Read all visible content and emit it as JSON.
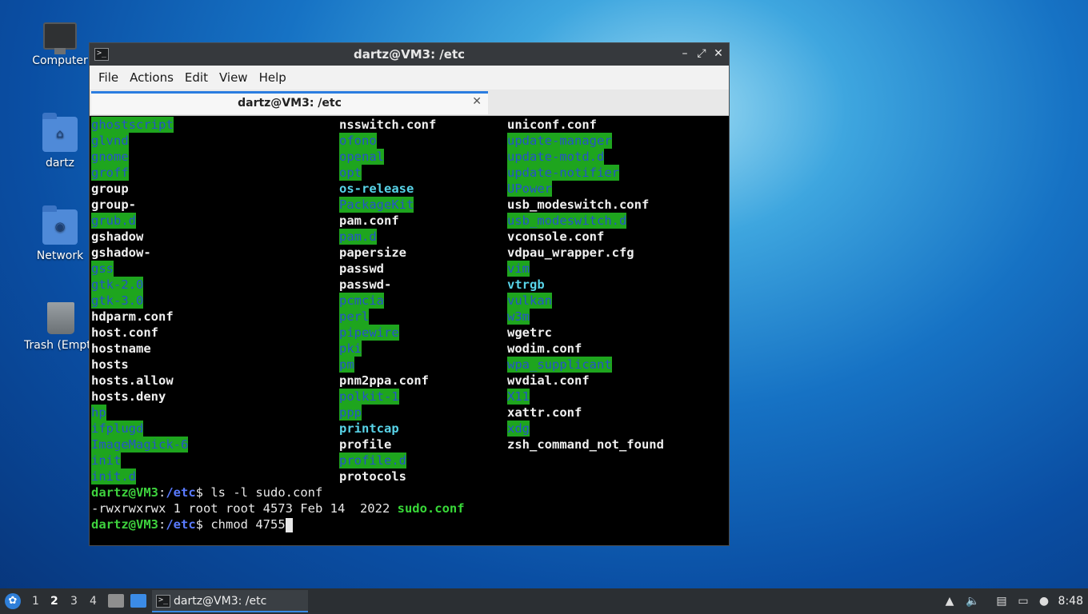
{
  "desktop": {
    "icons": [
      {
        "label": "Computer"
      },
      {
        "label": "dartz"
      },
      {
        "label": "Network"
      },
      {
        "label": "Trash (Empty)"
      }
    ]
  },
  "window": {
    "title": "dartz@VM3: /etc",
    "menu": [
      "File",
      "Actions",
      "Edit",
      "View",
      "Help"
    ],
    "tab_title": "dartz@VM3: /etc",
    "controls": {
      "minimize": "–",
      "maximize": "⤢",
      "close": "✕"
    }
  },
  "terminal": {
    "columns": [
      [
        {
          "name": "ghostscript",
          "type": "dir"
        },
        {
          "name": "glvnd",
          "type": "dir"
        },
        {
          "name": "gnome",
          "type": "dir"
        },
        {
          "name": "groff",
          "type": "dir"
        },
        {
          "name": "group",
          "type": "file"
        },
        {
          "name": "group-",
          "type": "file"
        },
        {
          "name": "grub.d",
          "type": "dir"
        },
        {
          "name": "gshadow",
          "type": "file"
        },
        {
          "name": "gshadow-",
          "type": "file"
        },
        {
          "name": "gss",
          "type": "dir"
        },
        {
          "name": "gtk-2.0",
          "type": "dir"
        },
        {
          "name": "gtk-3.0",
          "type": "dir"
        },
        {
          "name": "hdparm.conf",
          "type": "file"
        },
        {
          "name": "host.conf",
          "type": "file"
        },
        {
          "name": "hostname",
          "type": "file"
        },
        {
          "name": "hosts",
          "type": "file"
        },
        {
          "name": "hosts.allow",
          "type": "file"
        },
        {
          "name": "hosts.deny",
          "type": "file"
        },
        {
          "name": "hp",
          "type": "dir"
        },
        {
          "name": "ifplugd",
          "type": "dir"
        },
        {
          "name": "ImageMagick-6",
          "type": "dir"
        },
        {
          "name": "init",
          "type": "dir"
        },
        {
          "name": "init.d",
          "type": "dir"
        }
      ],
      [
        {
          "name": "nsswitch.conf",
          "type": "file"
        },
        {
          "name": "ofono",
          "type": "dir"
        },
        {
          "name": "openal",
          "type": "dir"
        },
        {
          "name": "opt",
          "type": "dir"
        },
        {
          "name": "os-release",
          "type": "link"
        },
        {
          "name": "PackageKit",
          "type": "dir"
        },
        {
          "name": "pam.conf",
          "type": "file"
        },
        {
          "name": "pam.d",
          "type": "dir"
        },
        {
          "name": "papersize",
          "type": "file"
        },
        {
          "name": "passwd",
          "type": "file"
        },
        {
          "name": "passwd-",
          "type": "file"
        },
        {
          "name": "pcmcia",
          "type": "dir"
        },
        {
          "name": "perl",
          "type": "dir"
        },
        {
          "name": "pipewire",
          "type": "dir"
        },
        {
          "name": "pki",
          "type": "dir"
        },
        {
          "name": "pm",
          "type": "dir"
        },
        {
          "name": "pnm2ppa.conf",
          "type": "file"
        },
        {
          "name": "polkit-1",
          "type": "dir"
        },
        {
          "name": "ppp",
          "type": "dir"
        },
        {
          "name": "printcap",
          "type": "link"
        },
        {
          "name": "profile",
          "type": "file"
        },
        {
          "name": "profile.d",
          "type": "dir"
        },
        {
          "name": "protocols",
          "type": "file"
        }
      ],
      [
        {
          "name": "uniconf.conf",
          "type": "file"
        },
        {
          "name": "update-manager",
          "type": "dir"
        },
        {
          "name": "update-motd.d",
          "type": "dir"
        },
        {
          "name": "update-notifier",
          "type": "dir"
        },
        {
          "name": "UPower",
          "type": "dir"
        },
        {
          "name": "usb_modeswitch.conf",
          "type": "file"
        },
        {
          "name": "usb_modeswitch.d",
          "type": "dir"
        },
        {
          "name": "vconsole.conf",
          "type": "file"
        },
        {
          "name": "vdpau_wrapper.cfg",
          "type": "file"
        },
        {
          "name": "vim",
          "type": "dir"
        },
        {
          "name": "vtrgb",
          "type": "link"
        },
        {
          "name": "vulkan",
          "type": "dir"
        },
        {
          "name": "w3m",
          "type": "dir"
        },
        {
          "name": "wgetrc",
          "type": "file"
        },
        {
          "name": "wodim.conf",
          "type": "file"
        },
        {
          "name": "wpa_supplicant",
          "type": "dir"
        },
        {
          "name": "wvdial.conf",
          "type": "file"
        },
        {
          "name": "X11",
          "type": "dir"
        },
        {
          "name": "xattr.conf",
          "type": "file"
        },
        {
          "name": "xdg",
          "type": "dir"
        },
        {
          "name": "zsh_command_not_found",
          "type": "file"
        }
      ]
    ],
    "prompt_user": "dartz@VM3",
    "prompt_sep": ":",
    "prompt_path": "/etc",
    "prompt_end": "$ ",
    "command1": "ls -l sudo.conf",
    "ls_output_prefix": "-rwxrwxrwx 1 root root 4573 Feb 14  2022 ",
    "ls_output_name": "sudo.conf",
    "command2": "chmod 4755"
  },
  "taskbar": {
    "workspaces": [
      "1",
      "2",
      "3",
      "4"
    ],
    "active_workspace": "2",
    "task_label": "dartz@VM3: /etc",
    "clock": "8:48"
  }
}
